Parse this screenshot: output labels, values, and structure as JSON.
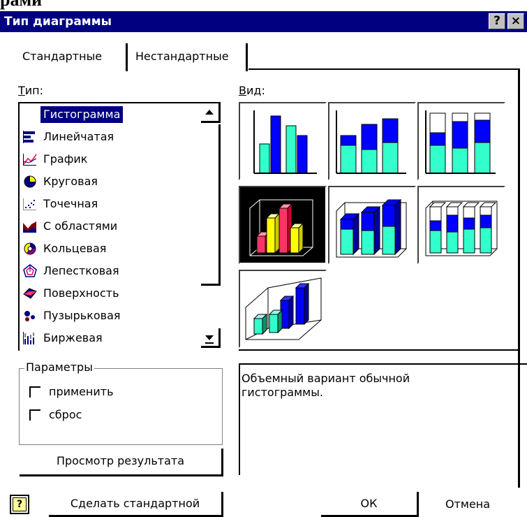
{
  "window": {
    "caption_fragment": "рами",
    "title": "Тип диаграммы",
    "help_button": "?",
    "close_button": "×"
  },
  "tabs": [
    {
      "label": "Стандартные",
      "active": true
    },
    {
      "label": "Нестандартные",
      "active": false
    }
  ],
  "type_section": {
    "label": "Тип:",
    "items": [
      {
        "label": "Гистограмма",
        "icon": "column-chart-icon",
        "selected": true
      },
      {
        "label": "Линейчатая",
        "icon": "bar-chart-icon"
      },
      {
        "label": "График",
        "icon": "line-chart-icon"
      },
      {
        "label": "Круговая",
        "icon": "pie-chart-icon"
      },
      {
        "label": "Точечная",
        "icon": "scatter-chart-icon"
      },
      {
        "label": "С областями",
        "icon": "area-chart-icon"
      },
      {
        "label": "Кольцевая",
        "icon": "doughnut-chart-icon"
      },
      {
        "label": "Лепестковая",
        "icon": "radar-chart-icon"
      },
      {
        "label": "Поверхность",
        "icon": "surface-chart-icon"
      },
      {
        "label": "Пузырьковая",
        "icon": "bubble-chart-icon"
      },
      {
        "label": "Биржевая",
        "icon": "stock-chart-icon"
      }
    ]
  },
  "view_section": {
    "label": "Вид:",
    "subtypes": [
      {
        "name": "clustered-column"
      },
      {
        "name": "stacked-column"
      },
      {
        "name": "100-stacked-column"
      },
      {
        "name": "3d-clustered-column",
        "selected": true
      },
      {
        "name": "3d-stacked-column"
      },
      {
        "name": "3d-100-stacked-column"
      },
      {
        "name": "3d-column"
      }
    ]
  },
  "params": {
    "label": "Параметры",
    "apply_label": "применить",
    "apply_checked": false,
    "reset_label": "сброс",
    "reset_checked": false
  },
  "description": "Объемный вариант обычной гистограммы.",
  "buttons": {
    "preview": "Просмотр результата",
    "set_default": "Сделать стандартной",
    "ok": "ОК",
    "cancel": "Отмена"
  },
  "colors": {
    "titlebar": "#000080",
    "selection": "#000080",
    "bar_green": "#33ffcc",
    "bar_blue": "#0000ff",
    "bar_yellow": "#ffff00",
    "bar_red": "#ff3366"
  }
}
